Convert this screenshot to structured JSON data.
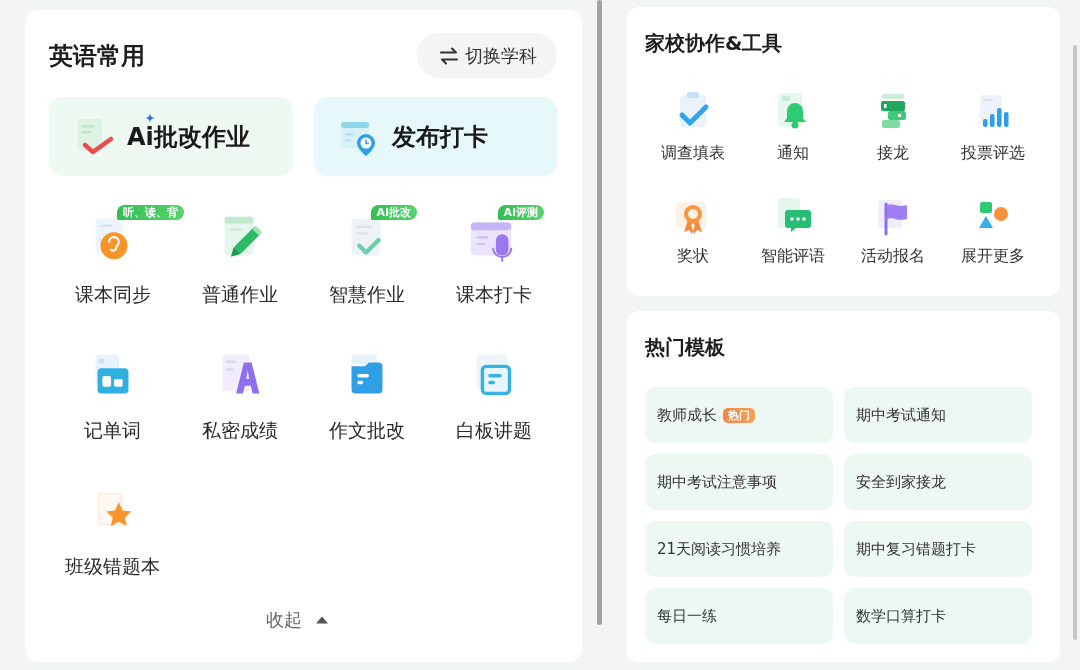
{
  "common": {
    "title": "英语常用",
    "switch_button": "切换学科",
    "featured": [
      {
        "label": "Ai批改作业"
      },
      {
        "label": "发布打卡"
      }
    ],
    "tools": [
      {
        "label": "课本同步",
        "tag": "听、读、背"
      },
      {
        "label": "普通作业"
      },
      {
        "label": "智慧作业",
        "tag": "AI批改"
      },
      {
        "label": "课本打卡",
        "tag": "AI评测"
      },
      {
        "label": "记单词"
      },
      {
        "label": "私密成绩"
      },
      {
        "label": "作文批改"
      },
      {
        "label": "白板讲题"
      },
      {
        "label": "班级错题本"
      }
    ],
    "collapse_button": "收起"
  },
  "home_school": {
    "title": "家校协作&工具",
    "tools": [
      {
        "label": "调查填表"
      },
      {
        "label": "通知"
      },
      {
        "label": "接龙"
      },
      {
        "label": "投票评选"
      },
      {
        "label": "奖状"
      },
      {
        "label": "智能评语"
      },
      {
        "label": "活动报名"
      },
      {
        "label": "展开更多"
      }
    ]
  },
  "templates": {
    "title": "热门模板",
    "items": [
      {
        "label": "教师成长",
        "tag": "热门"
      },
      {
        "label": "期中考试通知"
      },
      {
        "label": "期中考试注意事项"
      },
      {
        "label": "安全到家接龙"
      },
      {
        "label": "21天阅读习惯培养"
      },
      {
        "label": "期中复习错题打卡"
      },
      {
        "label": "每日一练"
      },
      {
        "label": "数学口算打卡"
      }
    ]
  }
}
